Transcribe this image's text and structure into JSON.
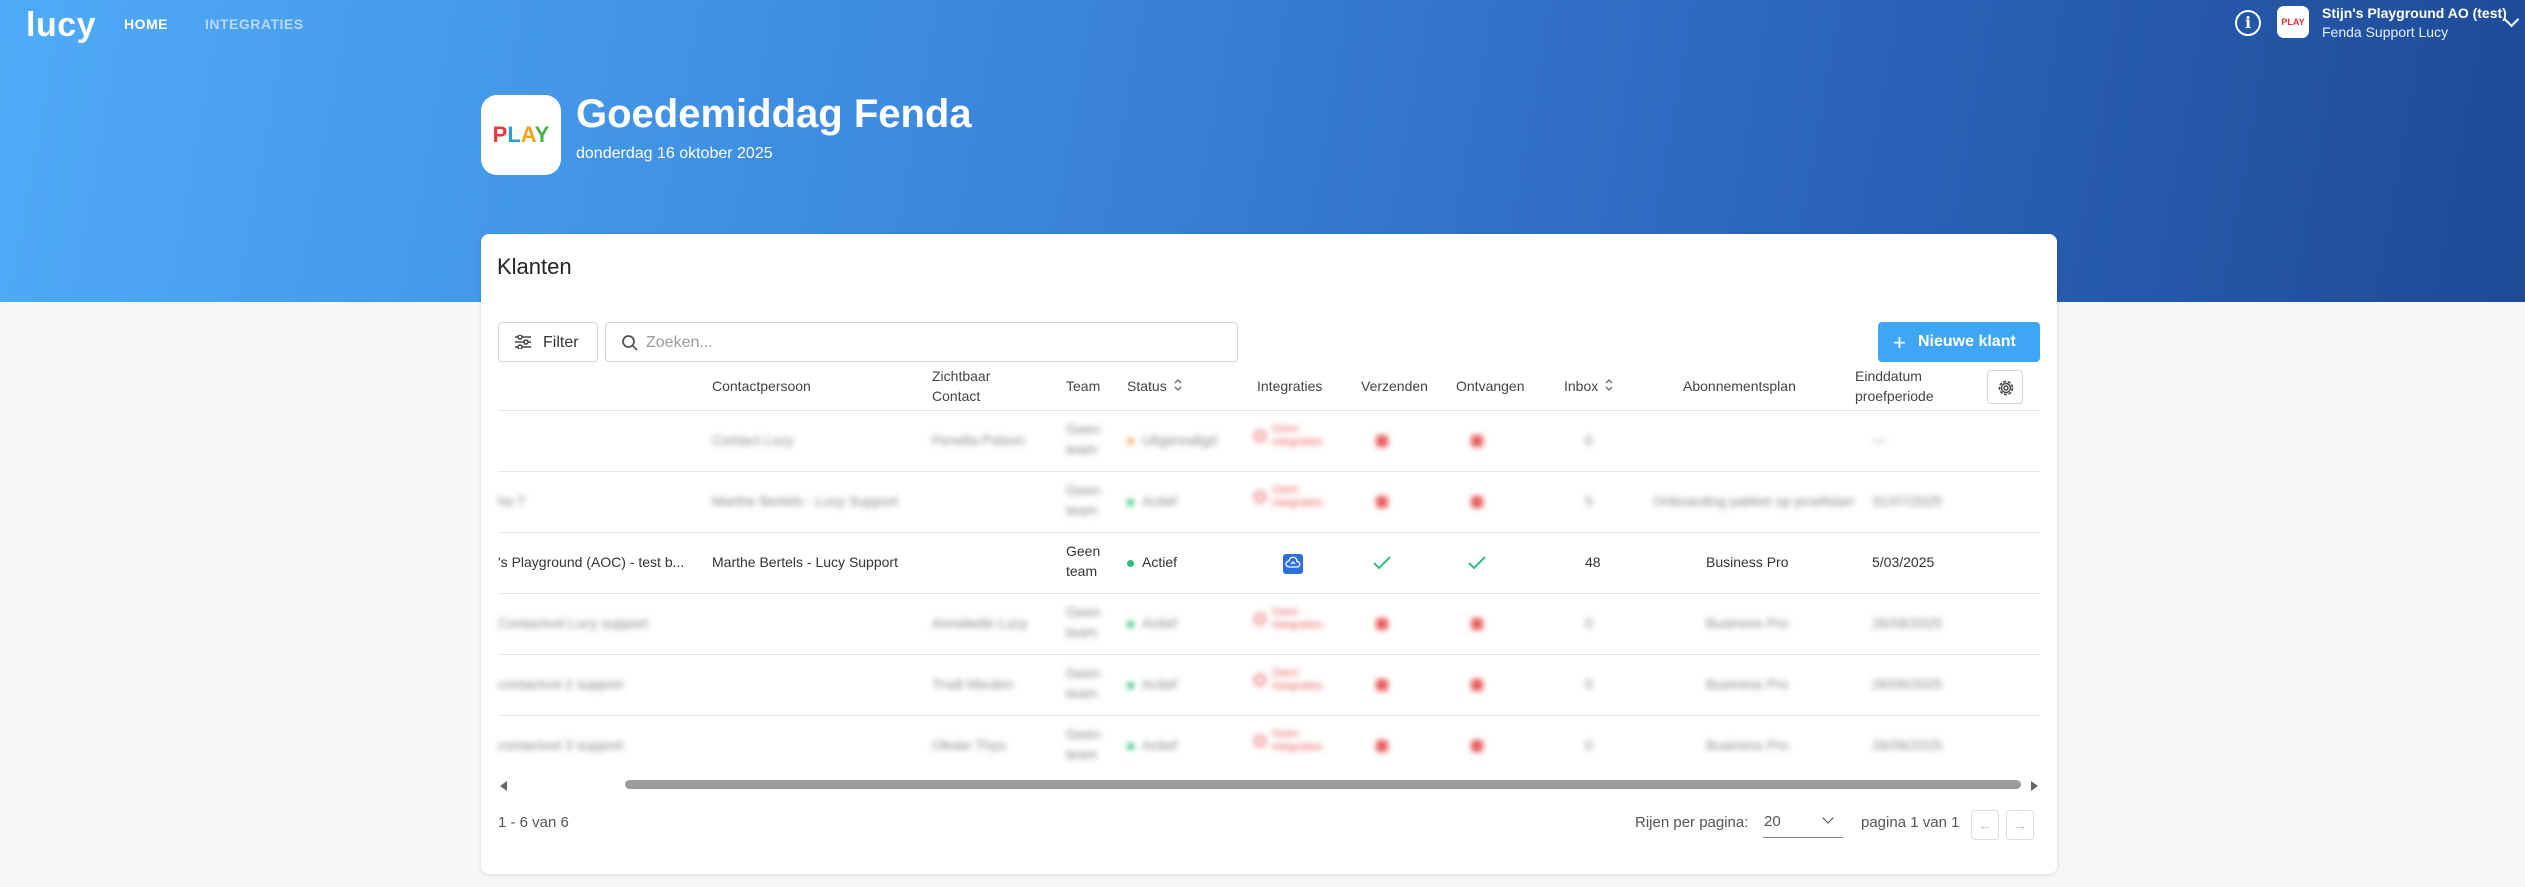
{
  "app": {
    "logo": "lucy"
  },
  "nav": {
    "home": "HOME",
    "integrations": "INTEGRATIES"
  },
  "account": {
    "logo_text": "PLAY",
    "name": "Stijn's Playground AO (test)",
    "subtitle": "Fenda Support Lucy"
  },
  "hero": {
    "brand": "PLAY",
    "greeting": "Goedemiddag Fenda",
    "date": "donderdag 16 oktober 2025"
  },
  "card": {
    "title": "Klanten"
  },
  "toolbar": {
    "filter_label": "Filter",
    "search_placeholder": "Zoeken...",
    "new_label": "Nieuwe klant"
  },
  "table": {
    "headers": {
      "contact": "Contactpersoon",
      "visible_contact_1": "Zichtbaar",
      "visible_contact_2": "Contact",
      "team": "Team",
      "status": "Status",
      "integrations": "Integraties",
      "send": "Verzenden",
      "receive": "Ontvangen",
      "inbox": "Inbox",
      "plan": "Abonnementsplan",
      "trial_end_1": "Einddatum",
      "trial_end_2": "proefperiode"
    },
    "rows": [
      {
        "name": "",
        "contact": "Contact Lucy",
        "visible": "Fenella Polson",
        "team_1": "Geen",
        "team_2": "team",
        "status": "Uitgenodigd",
        "integ_1": "Geen",
        "integ_2": "integraties",
        "inbox": "0",
        "plan": "",
        "trial": "—",
        "blurred": true,
        "status_color": "#f5a25c"
      },
      {
        "name": "he.T",
        "contact": "Marthe Bertels - Lucy Support",
        "visible": "",
        "team_1": "Geen",
        "team_2": "team",
        "status": "Actief",
        "integ_1": "Geen",
        "integ_2": "integraties",
        "inbox": "5",
        "plan": "Onboarding pakket op proefstart",
        "trial": "31/07/2025",
        "blurred": true,
        "status_color": "#2ebf7a"
      },
      {
        "name": "'s Playground (AOC) - test b...",
        "contact": "Marthe Bertels - Lucy Support",
        "visible": "",
        "team_1": "Geen",
        "team_2": "team",
        "status": "Actief",
        "integ_1": "",
        "integ_2": "",
        "inbox": "48",
        "plan": "Business Pro",
        "trial": "5/03/2025",
        "blurred": false,
        "status_color": "#2ebf7a"
      },
      {
        "name": "Contactvol Lucy support",
        "contact": "",
        "visible": "Annabelle Lucy",
        "team_1": "Geen",
        "team_2": "team",
        "status": "Actief",
        "integ_1": "Geen",
        "integ_2": "integraties",
        "inbox": "0",
        "plan": "Business Pro",
        "trial": "26/06/2025",
        "blurred": true,
        "status_color": "#2ebf7a"
      },
      {
        "name": "contactvol 2 support",
        "contact": "",
        "visible": "Trudi Meulen",
        "team_1": "Geen",
        "team_2": "team",
        "status": "Actief",
        "integ_1": "Geen",
        "integ_2": "integraties",
        "inbox": "0",
        "plan": "Business Pro",
        "trial": "26/06/2025",
        "blurred": true,
        "status_color": "#2ebf7a"
      },
      {
        "name": "contactvol 3 support",
        "contact": "",
        "visible": "Olivier Thys",
        "team_1": "Geen",
        "team_2": "team",
        "status": "Actief",
        "integ_1": "Geen",
        "integ_2": "integraties",
        "inbox": "0",
        "plan": "Business Pro",
        "trial": "26/06/2025",
        "blurred": true,
        "status_color": "#2ebf7a"
      }
    ]
  },
  "pagination": {
    "range": "1 - 6 van 6",
    "rows_per_page_label": "Rijen per pagina:",
    "rows_per_page": "20",
    "page_info": "pagina 1 van 1"
  },
  "colors": {
    "accent": "#3fa6f6",
    "active": "#2ebf7a",
    "error": "#e85a5a",
    "integration_icon": "#2f6ee0"
  }
}
